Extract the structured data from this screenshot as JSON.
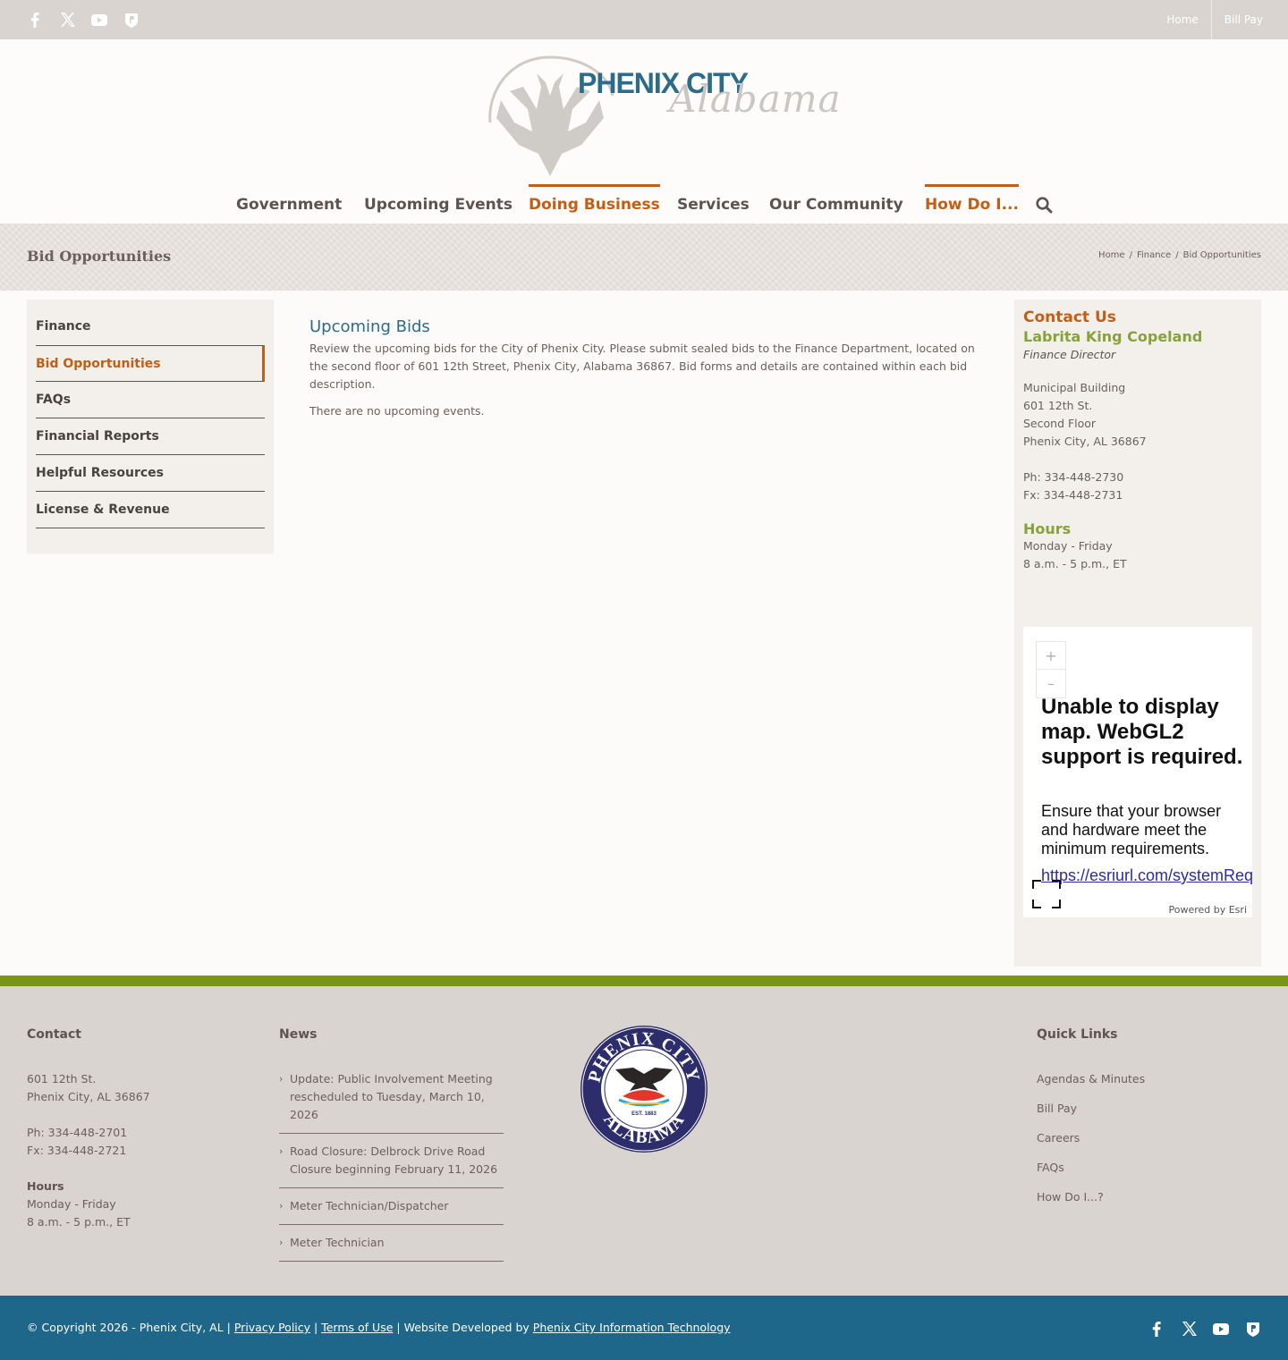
{
  "topbar": {
    "social_icons": [
      "facebook-icon",
      "x-icon",
      "youtube-icon",
      "shield-app-icon"
    ],
    "links": [
      "Home",
      "Bill Pay"
    ]
  },
  "logo": {
    "title": "PHENIX CITY",
    "script": "Alabama"
  },
  "nav": {
    "items": [
      {
        "label": "Government",
        "active": false
      },
      {
        "label": "Upcoming Events",
        "active": false
      },
      {
        "label": "Doing Business",
        "active": true
      },
      {
        "label": "Services",
        "active": false
      },
      {
        "label": "Our Community",
        "active": false
      },
      {
        "label": "How Do I...",
        "active": true
      }
    ]
  },
  "pagebar": {
    "title": "Bid Opportunities",
    "breadcrumb": [
      "Home",
      "Finance",
      "Bid Opportunities"
    ],
    "separator": "/"
  },
  "sidebar": {
    "items": [
      "Finance",
      "Bid Opportunities",
      "FAQs",
      "Financial Reports",
      "Helpful Resources",
      "License & Revenue"
    ],
    "active_index": 1,
    "submenu_chevron": "›"
  },
  "main": {
    "heading": "Upcoming Bids",
    "intro": "Review the upcoming bids for the City of Phenix City. Please submit sealed bids to the Finance Department, located on the second floor of 601 12th Street, Phenix City, Alabama 36867. Bid forms and details are contained within each bid description.",
    "empty": "There are no upcoming events."
  },
  "contact": {
    "heading": "Contact Us",
    "name": "Labrita King Copeland",
    "role": "Finance Director",
    "address": [
      "Municipal Building",
      "601 12th St.",
      "Second Floor",
      "Phenix City, AL 36867"
    ],
    "phone": "Ph: 334-448-2730",
    "fax": "Fx: 334-448-2731",
    "hours_heading": "Hours",
    "hours": [
      "Monday - Friday",
      "8 a.m. - 5 p.m., ET"
    ]
  },
  "map": {
    "zoom_in": "+",
    "zoom_out": "–",
    "error_heading": "Unable to display map. WebGL2 support is required.",
    "error_text": "Ensure that your browser and hardware meet the minimum requirements.",
    "error_link": "https://esriurl.com/systemReq",
    "powered": "Powered by Esri"
  },
  "footer": {
    "contact": {
      "heading": "Contact",
      "address": [
        "601 12th St.",
        "Phenix City, AL 36867"
      ],
      "phone": "Ph: 334-448-2701",
      "fax": "Fx: 334-448-2721",
      "hours_heading": "Hours",
      "hours": [
        "Monday - Friday",
        "8 a.m. - 5 p.m., ET"
      ]
    },
    "news": {
      "heading": "News",
      "items": [
        "Update: Public Involvement Meeting rescheduled to Tuesday, March 10, 2026",
        "Road Closure: Delbrock Drive Road Closure beginning February 11, 2026",
        "Meter Technician/Dispatcher",
        "Meter Technician"
      ]
    },
    "seal": {
      "top_text": "PHENIX CITY",
      "bottom_text": "ALABAMA",
      "est": "EST. 1883"
    },
    "quick": {
      "heading": "Quick Links",
      "items": [
        "Agendas & Minutes",
        "Bill Pay",
        "Careers",
        "FAQs",
        "How Do I...?"
      ]
    }
  },
  "bottom": {
    "copyright": "© Copyright 2026 - Phenix City, AL",
    "privacy": "Privacy Policy",
    "terms": "Terms of Use",
    "developed": "Website Developed by",
    "developer": "Phenix City Information Technology",
    "separator": "|"
  },
  "colors": {
    "accent": "#c45e14",
    "brand_blue": "#2b6c8a",
    "green": "#7a9615"
  }
}
